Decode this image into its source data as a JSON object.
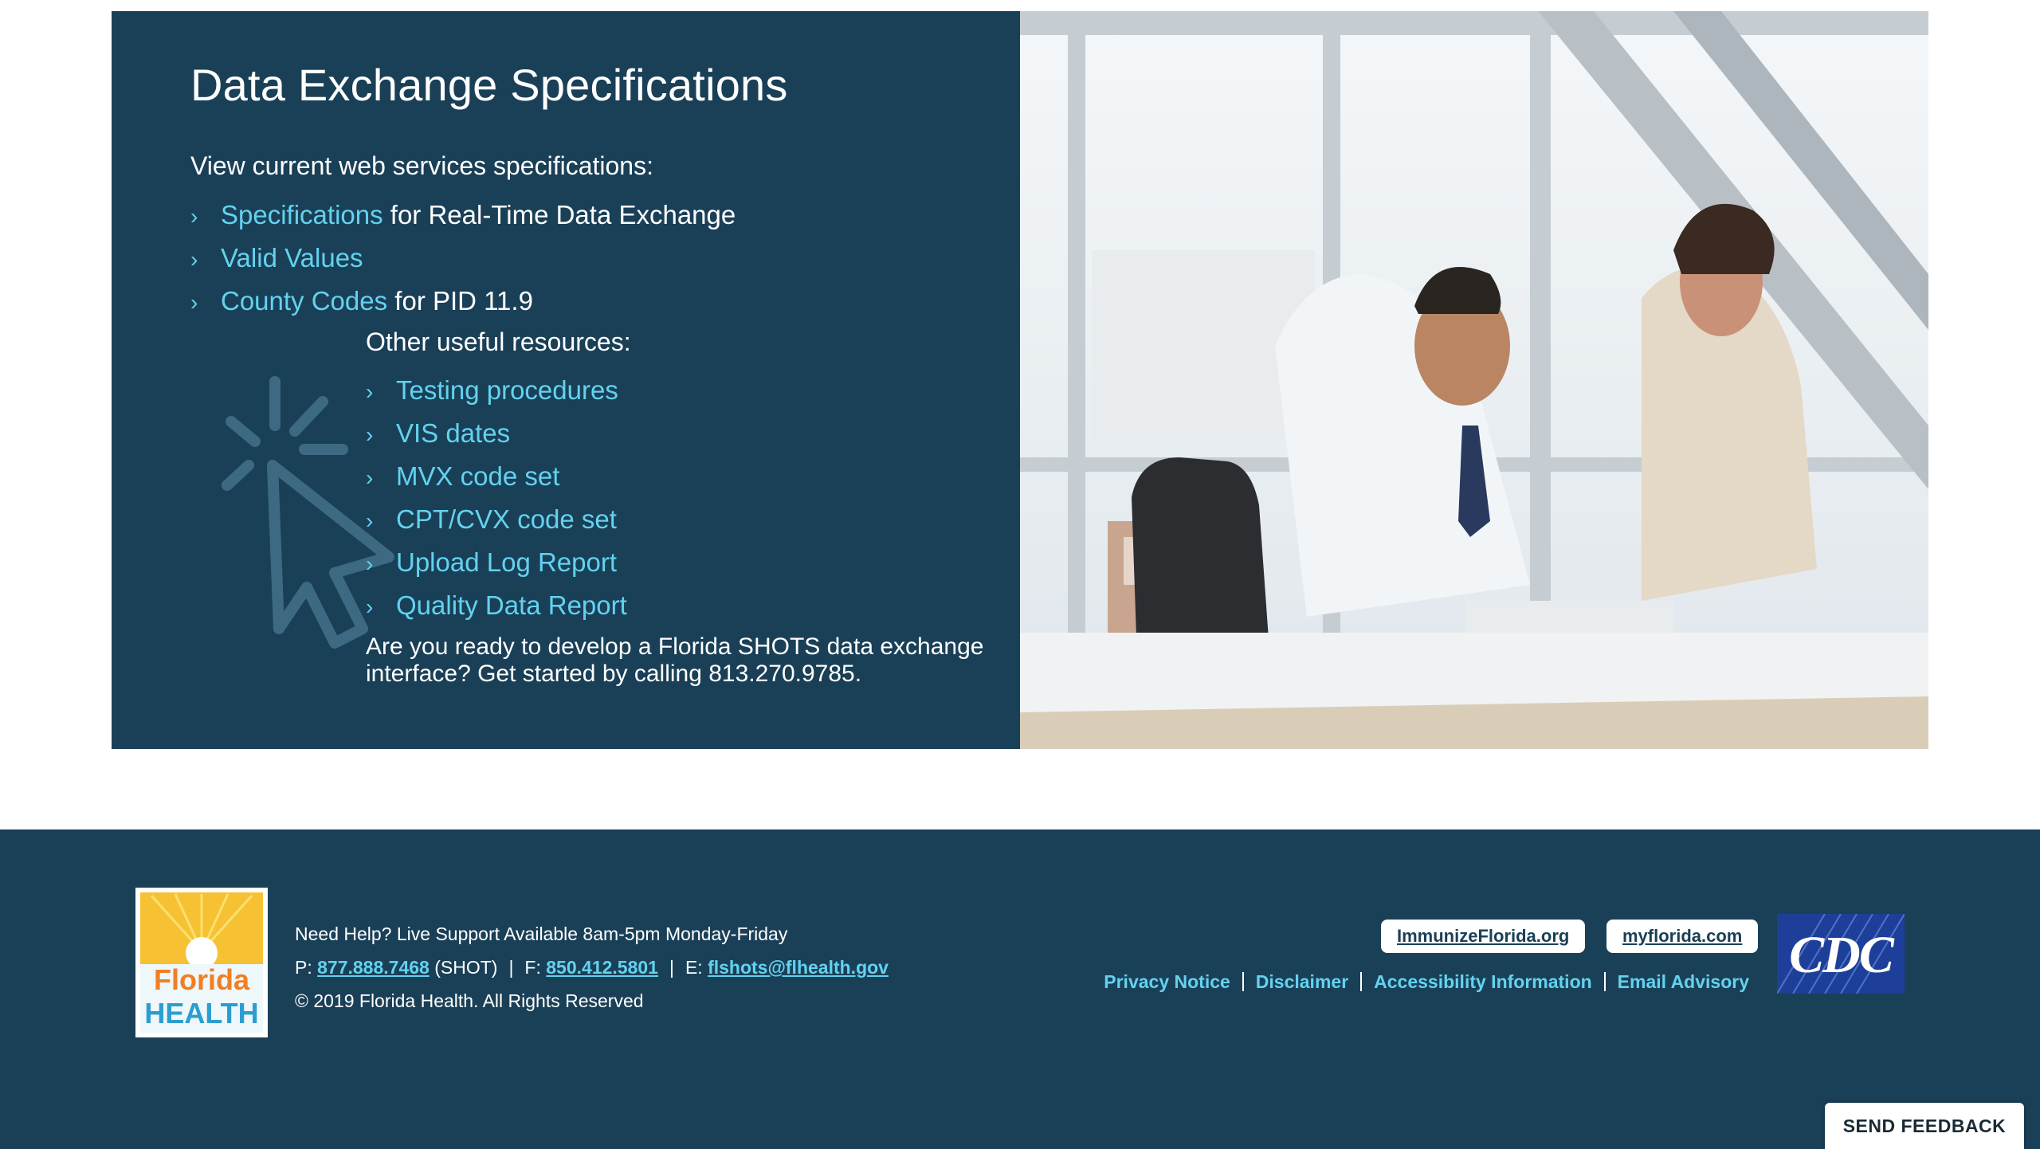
{
  "hero": {
    "title": "Data Exchange Specifications",
    "intro": "View current web services specifications:",
    "primary_links": [
      {
        "link": "Specifications",
        "rest": " for Real-Time Data Exchange"
      },
      {
        "link": "Valid Values",
        "rest": ""
      },
      {
        "link": "County Codes",
        "rest": " for PID 11.9"
      }
    ],
    "other_heading": "Other useful resources:",
    "other_links": [
      "Testing procedures",
      "VIS dates",
      "MVX code set",
      "CPT/CVX code set",
      "Upload Log Report",
      "Quality Data Report"
    ],
    "cta": "Are you ready to develop a Florida SHOTS data exchange interface? Get started by calling 813.270.9785."
  },
  "footer": {
    "logo_text_1": "Florida",
    "logo_text_2": "HEALTH",
    "help": "Need Help? Live Support Available 8am-5pm Monday-Friday",
    "phone_label": "P:",
    "phone": "877.888.7468",
    "phone_suffix": "(SHOT)",
    "fax_label": "F:",
    "fax": "850.412.5801",
    "email_label": "E:",
    "email": "flshots@flhealth.gov",
    "copyright": "© 2019 Florida Health. All Rights Reserved",
    "pills": [
      "ImmunizeFlorida.org",
      "myflorida.com"
    ],
    "policy_links": [
      "Privacy Notice",
      "Disclaimer",
      "Accessibility Information",
      "Email Advisory"
    ],
    "cdc_text": "CDC"
  },
  "feedback_label": "SEND FEEDBACK",
  "colors": {
    "navy": "#1a4057",
    "link": "#63d2ef",
    "cdc_blue": "#1d3f99"
  }
}
